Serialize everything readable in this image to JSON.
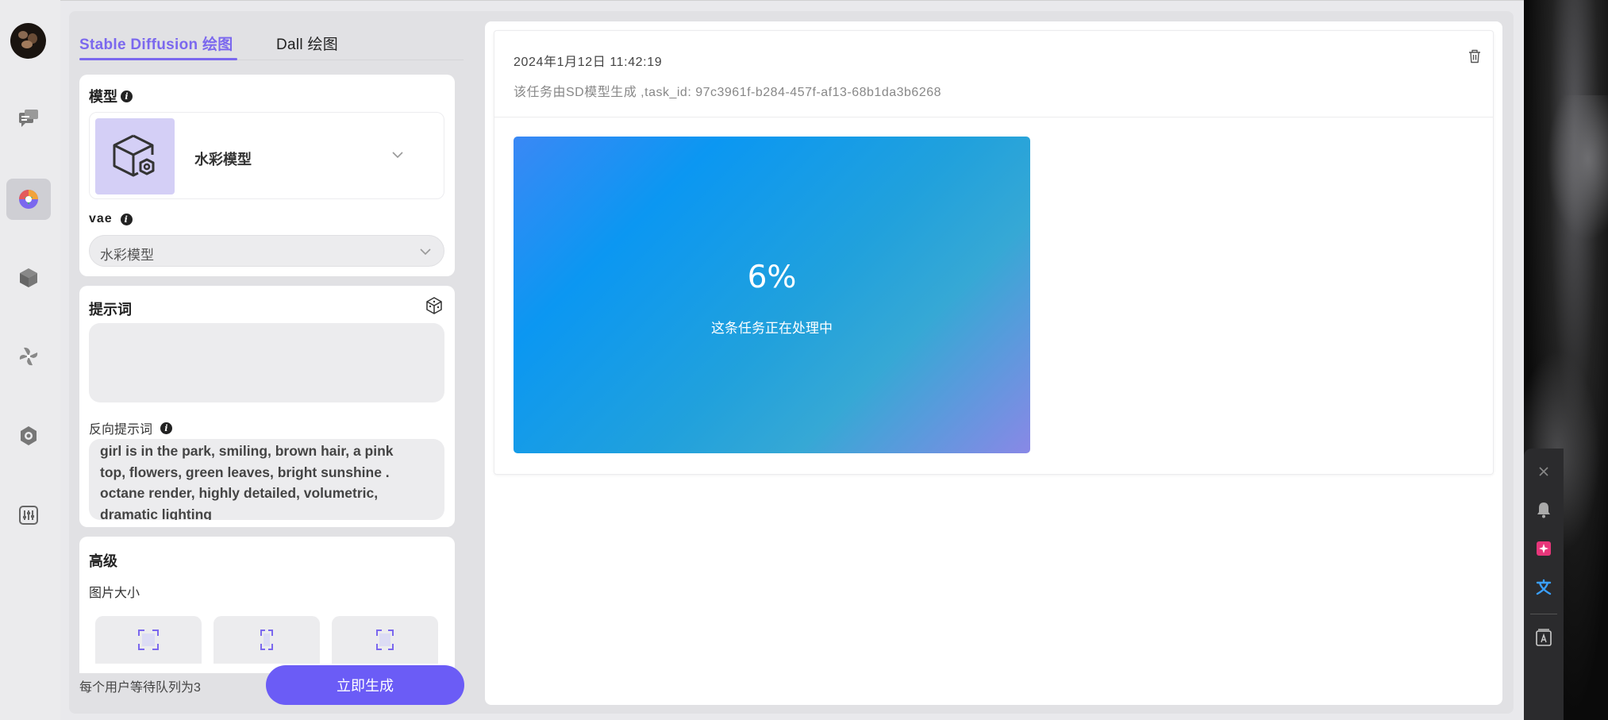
{
  "tabs": [
    {
      "label": "Stable Diffusion 绘图",
      "active": true
    },
    {
      "label": "Dall 绘图",
      "active": false
    }
  ],
  "model_section": {
    "title": "模型",
    "selected_model": "水彩模型"
  },
  "vae_section": {
    "title": "vae",
    "selected": "水彩模型"
  },
  "prompt_section": {
    "title": "提示词",
    "value": ""
  },
  "negative_prompt_section": {
    "title": "反向提示词",
    "lines": [
      "girl is in the park, smiling, brown hair, a pink",
      "top, flowers, green leaves, bright sunshine .",
      "octane render, highly detailed, volumetric,",
      "dramatic lighting"
    ]
  },
  "advanced_section": {
    "title": "高级",
    "image_size_label": "图片大小"
  },
  "footer": {
    "queue_text": "每个用户等待队列为3",
    "generate_label": "立即生成"
  },
  "task": {
    "time": "2024年1月12日 11:42:19",
    "description": "该任务由SD模型生成 ,task_id: 97c3961f-b284-457f-af13-68b1da3b6268",
    "progress_text": "6%",
    "progress_value": 0.06,
    "status_text": "这条任务正在处理中"
  },
  "colors": {
    "accent": "#7b68ee",
    "button": "#6b5cf6",
    "model_thumb_bg": "#d4cff6"
  },
  "icons": {
    "rail": [
      "avatar",
      "chat-icon",
      "paint-icon",
      "cube-icon",
      "pinwheel-icon",
      "hexagon-settings-icon",
      "sliders-icon"
    ],
    "side_tools": [
      "close-icon",
      "bell-icon",
      "star-badge-icon",
      "translate-icon",
      "reader-icon"
    ]
  }
}
